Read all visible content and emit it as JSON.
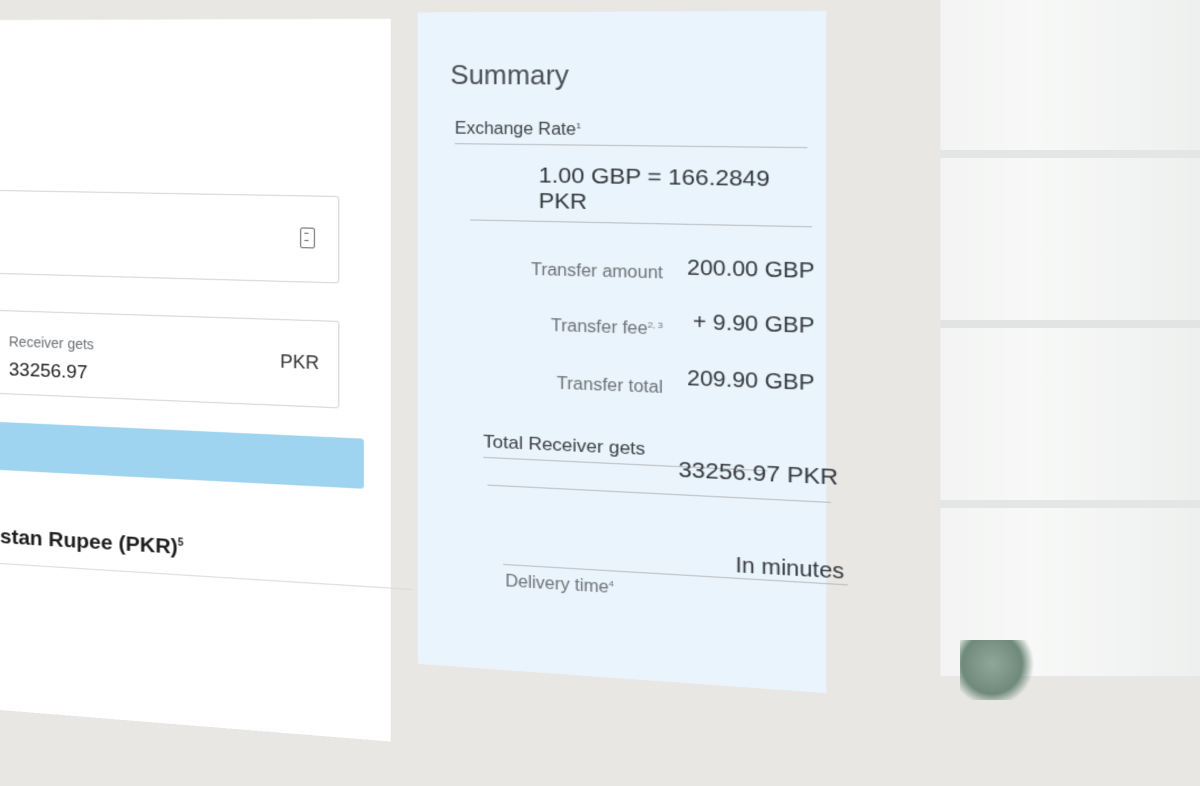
{
  "converter": {
    "receiver_label": "Receiver gets",
    "receiver_value": "33256.97",
    "receiver_currency": "PKR",
    "currency_title": "stan Rupee (PKR)",
    "currency_title_note": "5"
  },
  "summary": {
    "title": "Summary",
    "exchange_rate_label": "Exchange Rate",
    "exchange_rate_note": "1",
    "exchange_rate_value": "1.00 GBP = 166.2849 PKR",
    "transfer_amount_label": "Transfer amount",
    "transfer_amount_value": "200.00  GBP",
    "transfer_fee_label": "Transfer fee",
    "transfer_fee_note": "2, 3",
    "transfer_fee_value": "+ 9.90  GBP",
    "transfer_total_label": "Transfer total",
    "transfer_total_value": "209.90  GBP",
    "total_receiver_label": "Total Receiver gets",
    "total_receiver_value": "33256.97 PKR",
    "delivery_label": "Delivery time",
    "delivery_note": "4",
    "delivery_value": "In minutes"
  },
  "colors": {
    "summary_bg": "#eaf4fc",
    "cta_bg": "#9fd4f0",
    "screen_bg": "#e8e7e3"
  }
}
